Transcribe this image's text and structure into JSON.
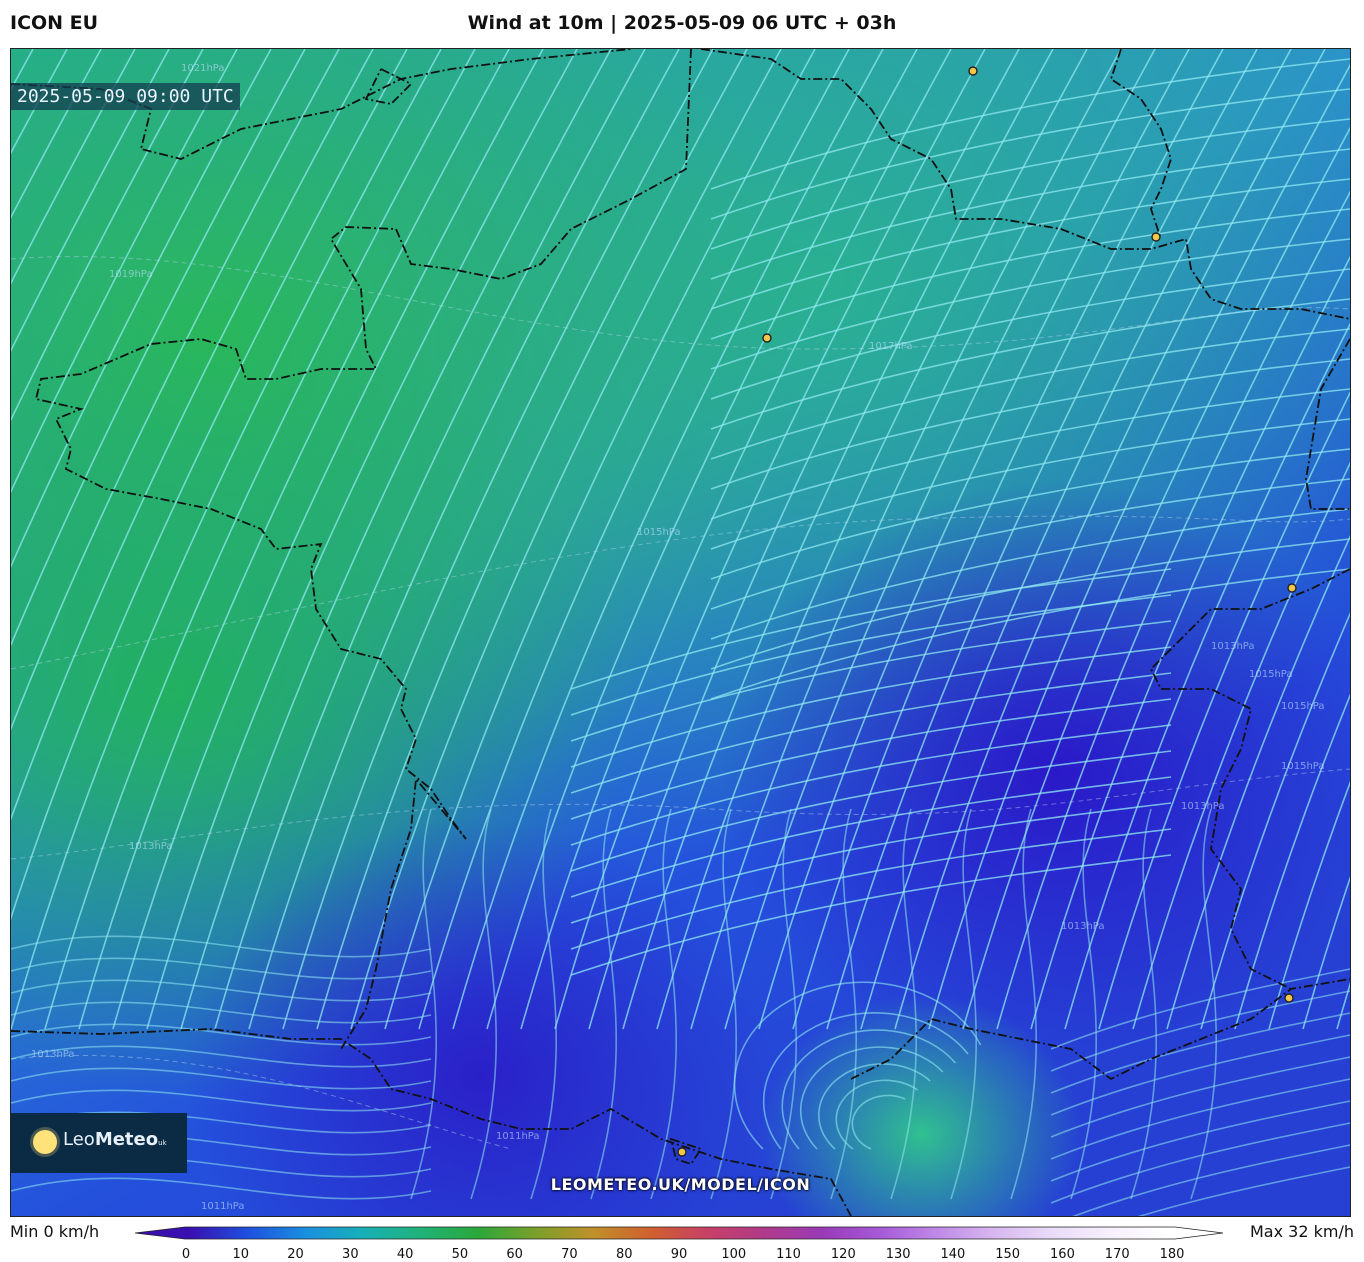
{
  "header": {
    "model": "ICON EU",
    "title": "Wind at 10m | 2025-05-09 06 UTC + 03h"
  },
  "map": {
    "valid_time": "2025-05-09 09:00 UTC",
    "watermark": "LEOMETEO.UK/MODEL/ICON",
    "logo": {
      "name_light": "Leo",
      "name_bold": "Meteo",
      "suffix": "uk"
    },
    "isobar_labels": [
      "1021hPa",
      "1019hPa",
      "1017hPa",
      "1015hPa",
      "1013hPa",
      "1013hPa",
      "1013hPa",
      "1011hPa",
      "1011hPa",
      "1015hPa",
      "1015hPa",
      "1015hPa",
      "1013hPa",
      "1013hPa"
    ]
  },
  "legend": {
    "min_label": "Min 0 km/h",
    "max_label": "Max 32 km/h",
    "ticks": [
      "0",
      "10",
      "20",
      "30",
      "40",
      "50",
      "60",
      "70",
      "80",
      "90",
      "100",
      "110",
      "120",
      "130",
      "140",
      "150",
      "160",
      "170",
      "180"
    ],
    "colors": [
      "#3a0fb0",
      "#1e4fe0",
      "#1a8fe0",
      "#18b0b8",
      "#1fb37a",
      "#2aa83a",
      "#7aa02a",
      "#c0902a",
      "#d0602e",
      "#c84066",
      "#b03a8a",
      "#9a3ab8",
      "#a65ad8",
      "#c08ae8",
      "#d8b8f0",
      "#eadcf8",
      "#f6f0fc",
      "#ffffff"
    ]
  }
}
